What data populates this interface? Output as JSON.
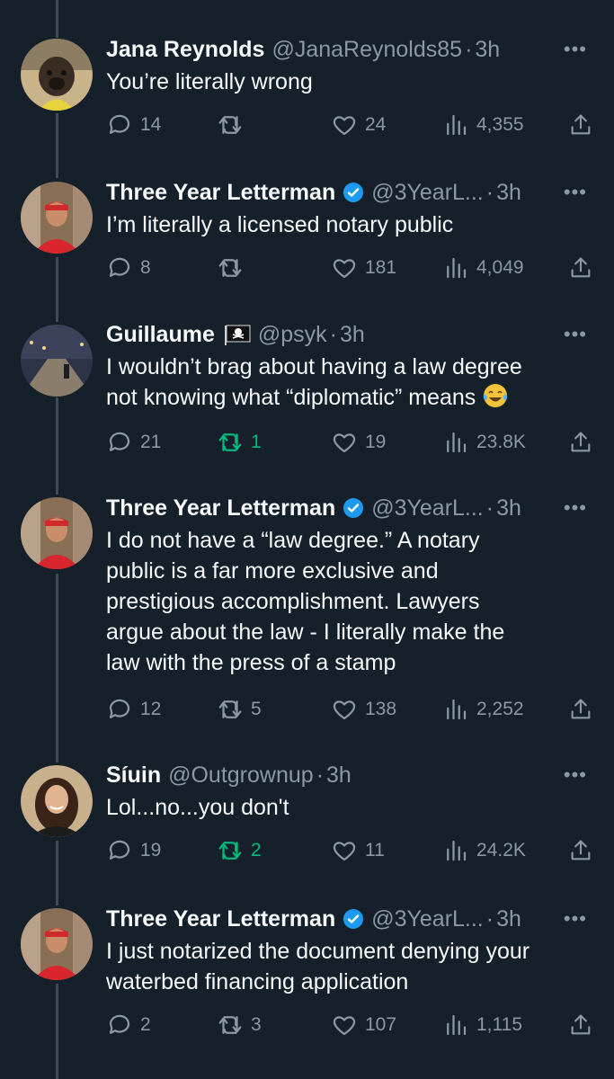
{
  "tweets": [
    {
      "name": "Jana Reynolds",
      "handle": "@JanaReynolds85",
      "time": "3h",
      "verified": false,
      "text": "You’re literally wrong",
      "replies": "14",
      "retweets": "",
      "likes": "24",
      "views": "4,355",
      "retweet_active": false,
      "avatar": "dog-avatar"
    },
    {
      "name": "Three Year Letterman",
      "handle": "@3YearL...",
      "time": "3h",
      "verified": true,
      "text": "I’m literally a licensed notary public",
      "replies": "8",
      "retweets": "",
      "likes": "181",
      "views": "4,049",
      "retweet_active": false,
      "avatar": "man-red-cap-avatar"
    },
    {
      "name": "Guillaume",
      "handle": "@psyk",
      "time": "3h",
      "verified": false,
      "flag": "pirate-flag-icon",
      "text_lines": [
        "I wouldn’t brag about having a law degree",
        "not knowing what “diplomatic” means"
      ],
      "emoji": "laughing-crying-emoji",
      "replies": "21",
      "retweets": "1",
      "likes": "19",
      "views": "23.8K",
      "retweet_active": true,
      "avatar": "street-night-avatar"
    },
    {
      "name": "Three Year Letterman",
      "handle": "@3YearL...",
      "time": "3h",
      "verified": true,
      "text_lines": [
        "I do not have a “law degree.” A notary",
        "public is a far more exclusive and",
        "prestigious accomplishment. Lawyers",
        "argue about the law - I literally make the",
        "law with the press of a stamp"
      ],
      "replies": "12",
      "retweets": "5",
      "likes": "138",
      "views": "2,252",
      "retweet_active": false,
      "avatar": "man-red-cap-avatar"
    },
    {
      "name": "Síuin",
      "handle": "@Outgrownup",
      "time": "3h",
      "verified": false,
      "text": "Lol...no...you don't",
      "replies": "19",
      "retweets": "2",
      "likes": "11",
      "views": "24.2K",
      "retweet_active": true,
      "avatar": "woman-avatar"
    },
    {
      "name": "Three Year Letterman",
      "handle": "@3YearL...",
      "time": "3h",
      "verified": true,
      "text_lines": [
        "I just notarized the document denying your",
        "waterbed financing application"
      ],
      "replies": "2",
      "retweets": "3",
      "likes": "107",
      "views": "1,115",
      "retweet_active": false,
      "avatar": "man-red-cap-avatar"
    }
  ],
  "dot": "·",
  "more": "•••",
  "colors": {
    "background": "#15202b",
    "muted": "#8b98a5",
    "retweet_active": "#00ba7c",
    "verified": "#1d9bf0"
  }
}
